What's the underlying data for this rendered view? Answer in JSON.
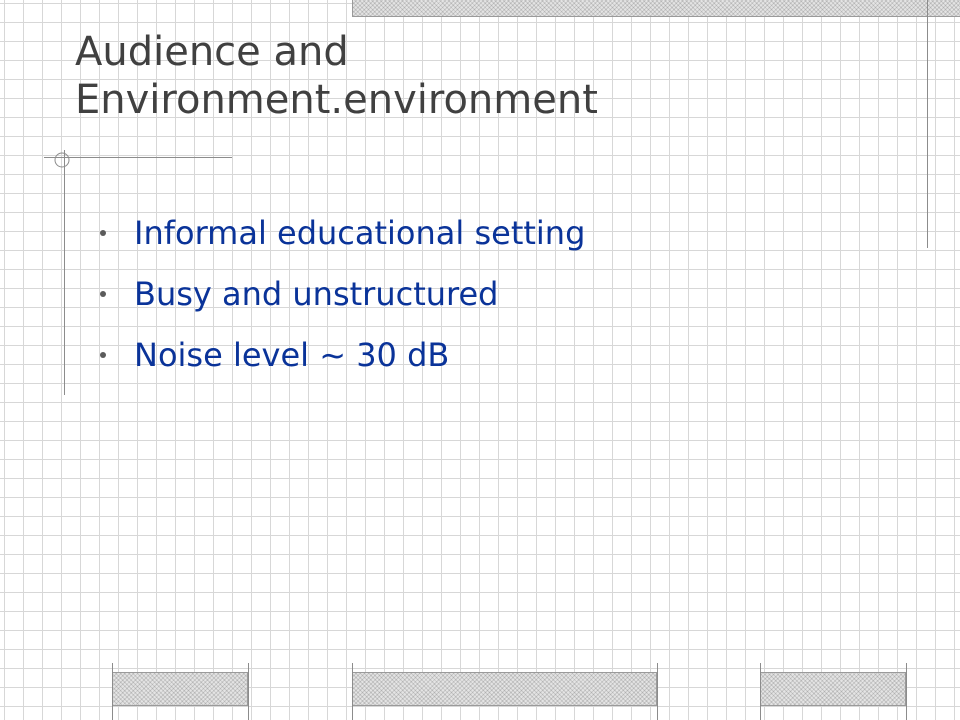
{
  "slide": {
    "title_lines": [
      "Audience and",
      "Environment.environment"
    ],
    "bullets": [
      "Informal educational setting",
      "Busy and unstructured",
      "Noise level ~ 30 dB"
    ]
  },
  "colors": {
    "title": "#404040",
    "bullet_text": "#0a3399",
    "grid": "#d7d7d7",
    "background": "#ffffff"
  }
}
